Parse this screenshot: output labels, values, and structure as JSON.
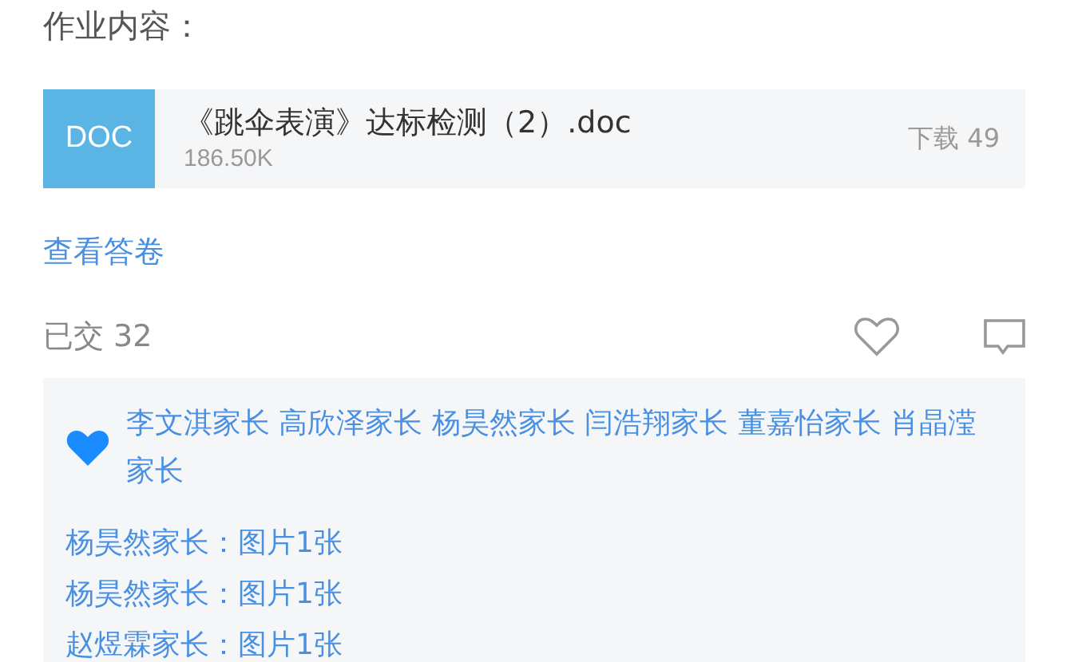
{
  "section_title": "作业内容：",
  "file": {
    "type_label": "DOC",
    "name": "《跳伞表演》达标检测（2）.doc",
    "size": "186.50K",
    "downloads": "下载 49"
  },
  "view_answers": "查看答卷",
  "submitted": "已交 32",
  "likers": [
    "李文淇家长",
    "高欣泽家长",
    "杨昊然家长",
    "闫浩翔家长",
    "董嘉怡家长",
    "肖晶滢家长"
  ],
  "comments": [
    {
      "text": "杨昊然家长：图片1张"
    },
    {
      "text": "杨昊然家长：图片1张"
    },
    {
      "text": "赵煜霖家长：图片1张"
    }
  ]
}
